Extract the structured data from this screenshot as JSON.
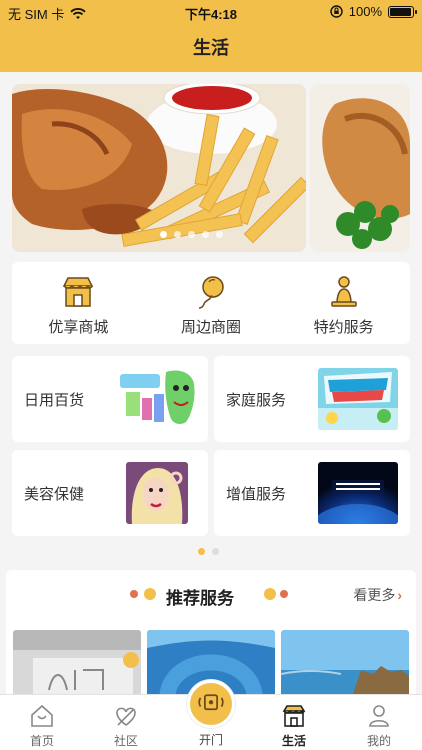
{
  "status_bar": {
    "carrier": "无 SIM 卡",
    "time": "下午4:18",
    "battery": "100%",
    "battery_level": 1.0
  },
  "header": {
    "title": "生活"
  },
  "banner": {
    "slide_count": 5,
    "active_slide": 0
  },
  "quick_menu": [
    {
      "label": "优享商城",
      "icon": "shop-icon"
    },
    {
      "label": "周边商圈",
      "icon": "balloon-icon"
    },
    {
      "label": "特约服务",
      "icon": "person-icon"
    }
  ],
  "services": [
    {
      "label": "日用百货",
      "thumb": "daily-goods-thumbnail"
    },
    {
      "label": "家庭服务",
      "thumb": "home-service-thumbnail"
    },
    {
      "label": "美容保健",
      "thumb": "beauty-thumbnail"
    },
    {
      "label": "增值服务",
      "thumb": "value-added-thumbnail"
    }
  ],
  "services_page": {
    "count": 2,
    "active": 0
  },
  "recommend": {
    "title": "推荐服务",
    "more": "看更多"
  },
  "tabbar": [
    {
      "label": "首页",
      "icon": "home-icon"
    },
    {
      "label": "社区",
      "icon": "community-icon"
    },
    {
      "label": "开门",
      "icon": "door-open-icon"
    },
    {
      "label": "生活",
      "icon": "life-icon"
    },
    {
      "label": "我的",
      "icon": "profile-icon"
    }
  ],
  "colors": {
    "accent": "#f2c04a",
    "highlight_red": "#e07050"
  }
}
